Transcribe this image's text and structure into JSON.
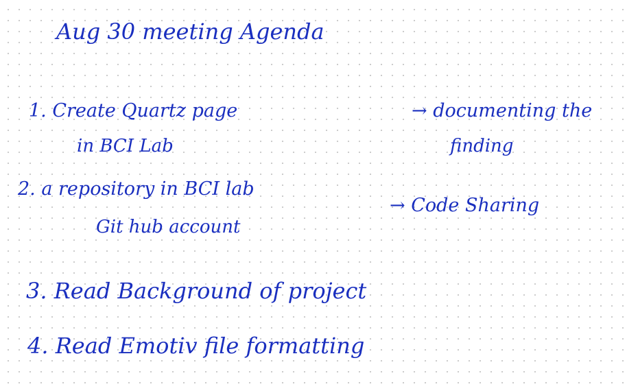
{
  "note": {
    "title": "Aug 30 meeting Agenda",
    "items": [
      {
        "task_line1": "1. Create Quartz page",
        "task_line2": "in BCI Lab",
        "purpose_line1": "→ documenting the",
        "purpose_line2": "finding"
      },
      {
        "task_line1": "2. a repository in BCI lab",
        "task_line2": "Git hub account",
        "purpose_line1": "→ Code Sharing"
      },
      {
        "task_line1": "3. Read Background of project"
      },
      {
        "task_line1": "4. Read Emotiv file formatting"
      }
    ]
  },
  "colors": {
    "ink": "#1a2fbf",
    "paper": "#ffffff",
    "dot_grid": "#c9c9c9"
  }
}
